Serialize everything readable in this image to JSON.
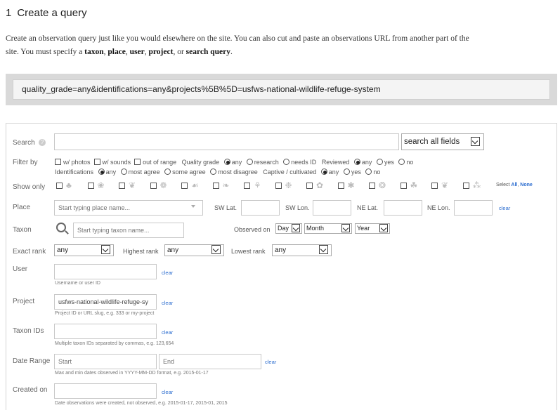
{
  "heading": {
    "number": "1",
    "title": "Create a query"
  },
  "intro": {
    "line1": "Create an observation query just like you would elsewhere on the site. You can also cut and paste an observations URL from another part of the",
    "line2_pre": "site. You must specify a ",
    "req1": "taxon",
    "sep1": ", ",
    "req2": "place",
    "sep2": ", ",
    "req3": "user",
    "sep3": ", ",
    "req4": "project",
    "sep4": ", or ",
    "req5": "search query",
    "end": "."
  },
  "query_string": "quality_grade=any&identifications=any&projects%5B%5D=usfws-national-wildlife-refuge-system",
  "form": {
    "search": {
      "label": "Search",
      "value": "",
      "scope": "search all fields"
    },
    "filter_by": {
      "label": "Filter by",
      "photos": "w/ photos",
      "sounds": "w/ sounds",
      "out_of_range": "out of range",
      "quality_grade_label": "Quality grade",
      "qg_any": "any",
      "qg_research": "research",
      "qg_needs_id": "needs ID",
      "reviewed_label": "Reviewed",
      "rev_any": "any",
      "rev_yes": "yes",
      "rev_no": "no",
      "identifications_label": "Identifications",
      "id_any": "any",
      "id_most_agree": "most agree",
      "id_some_agree": "some agree",
      "id_most_disagree": "most disagree",
      "captive_label": "Captive / cultivated",
      "cap_any": "any",
      "cap_yes": "yes",
      "cap_no": "no"
    },
    "show_only": {
      "label": "Show only",
      "select_label": "Select",
      "all": "All",
      "none": "None",
      "taxa_icons": [
        "plant-icon",
        "fungus-icon",
        "bird-icon",
        "insect-icon",
        "mammal-icon",
        "fish-icon",
        "reptile-icon",
        "amphibian-icon",
        "mollusk-icon",
        "arachnid-icon",
        "protozoa-icon",
        "animal-icon",
        "chromista-icon",
        "unknown-icon"
      ]
    },
    "place": {
      "label": "Place",
      "placeholder": "Start typing place name...",
      "sw_lat": "SW Lat.",
      "sw_lon": "SW Lon.",
      "ne_lat": "NE Lat.",
      "ne_lon": "NE Lon.",
      "clear": "clear"
    },
    "taxon": {
      "label": "Taxon",
      "placeholder": "Start typing taxon name...",
      "observed_on": "Observed on",
      "day": "Day",
      "month": "Month",
      "year": "Year"
    },
    "rank": {
      "exact_label": "Exact rank",
      "exact_value": "any",
      "highest_label": "Highest rank",
      "highest_value": "any",
      "lowest_label": "Lowest rank",
      "lowest_value": "any"
    },
    "user": {
      "label": "User",
      "value": "",
      "clear": "clear",
      "hint": "Username or user ID"
    },
    "project": {
      "label": "Project",
      "value": "usfws-national-wildlife-refuge-sy",
      "clear": "clear",
      "hint": "Project ID or URL slug, e.g. 333 or my-project"
    },
    "taxon_ids": {
      "label": "Taxon IDs",
      "value": "",
      "clear": "clear",
      "hint": "Multiple taxon IDs separated by commas, e.g. 123,654"
    },
    "date_range": {
      "label": "Date Range",
      "start_placeholder": "Start",
      "end_placeholder": "End",
      "clear": "clear",
      "hint": "Max and min dates observed in YYYY-MM-DD format, e.g. 2015-01-17"
    },
    "created_on": {
      "label": "Created on",
      "value": "",
      "clear": "clear",
      "hint": "Date observations were created, not observed, e.g. 2015-01-17, 2015-01, 2015"
    }
  },
  "colors": {
    "link": "#2a6ccf",
    "url_bar_bg": "#d9d9d9",
    "border": "#d4d4d4"
  }
}
